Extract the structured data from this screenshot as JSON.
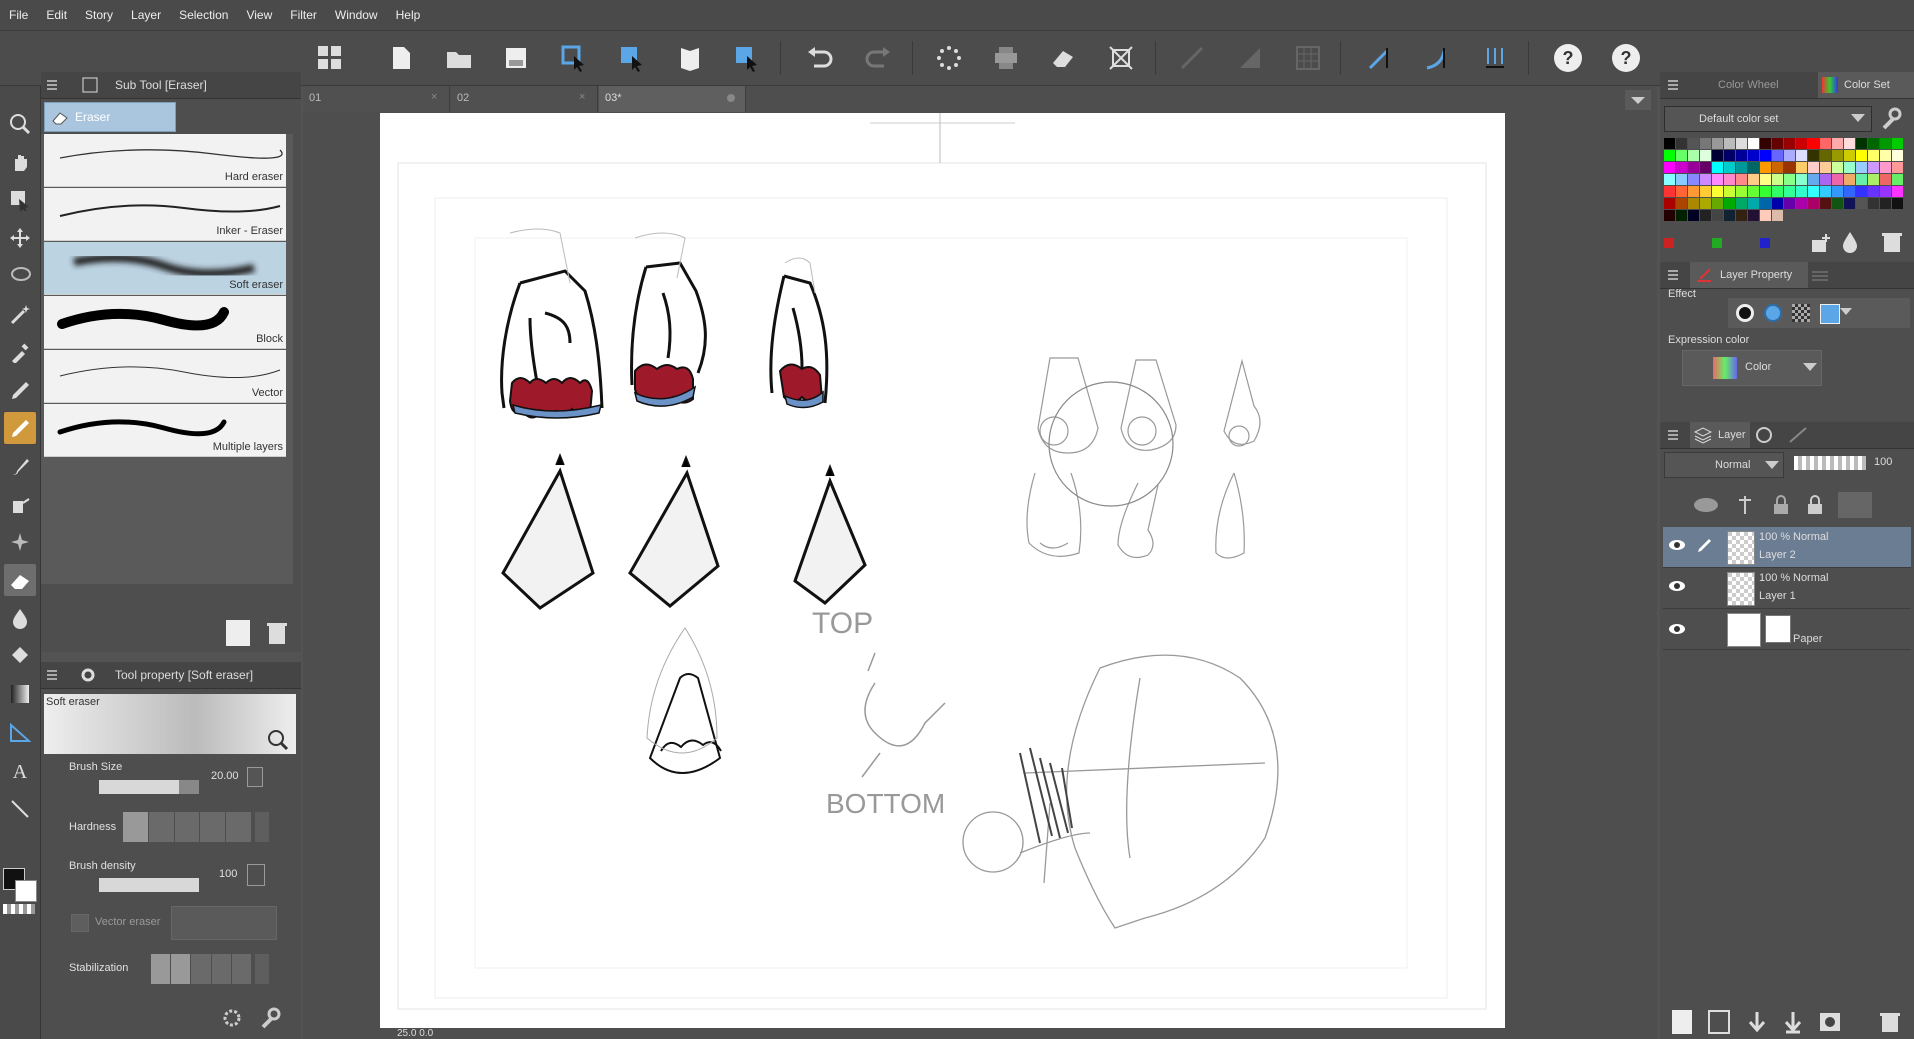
{
  "menu": [
    "File",
    "Edit",
    "Story",
    "Layer",
    "Selection",
    "View",
    "Filter",
    "Window",
    "Help"
  ],
  "subtool": {
    "title": "Sub Tool [Eraser]",
    "group": "Eraser",
    "brushes": [
      {
        "label": "Hard eraser"
      },
      {
        "label": "Inker - Eraser"
      },
      {
        "label": "Soft eraser"
      },
      {
        "label": "Block"
      },
      {
        "label": "Vector"
      },
      {
        "label": "Multiple layers"
      }
    ]
  },
  "toolprop": {
    "title": "Tool property [Soft eraser]",
    "preview_label": "Soft eraser",
    "brush_size_label": "Brush Size",
    "brush_size_value": "20.00",
    "hardness_label": "Hardness",
    "brush_density_label": "Brush density",
    "brush_density_value": "100",
    "vector_eraser_label": "Vector eraser",
    "stabilization_label": "Stabilization"
  },
  "doc_tabs": [
    "01",
    "02",
    "03*"
  ],
  "canvas": {
    "status": "25.0  0.0",
    "sketch_text_top": "TOP",
    "sketch_text_bottom": "BOTTOM"
  },
  "color_panel": {
    "tab_wheel": "Color Wheel",
    "tab_set": "Color Set",
    "set_name": "Default color set"
  },
  "layer_property": {
    "tab": "Layer Property",
    "effect_label": "Effect",
    "expression_label": "Expression color",
    "expression_value": "Color"
  },
  "layer_panel": {
    "tab": "Layer",
    "blend_mode": "Normal",
    "opacity": "100",
    "layers": [
      {
        "pct": "100 %",
        "mode": "Normal",
        "name": "Layer 2"
      },
      {
        "pct": "100 %",
        "mode": "Normal",
        "name": "Layer 1"
      },
      {
        "pct": "",
        "mode": "",
        "name": "Paper"
      }
    ]
  },
  "colors": {
    "accent": "#d09a3c",
    "selected_layer": "#6b7d93",
    "sketch_red": "#9e1a2a",
    "sketch_blue": "#6c93c8"
  }
}
